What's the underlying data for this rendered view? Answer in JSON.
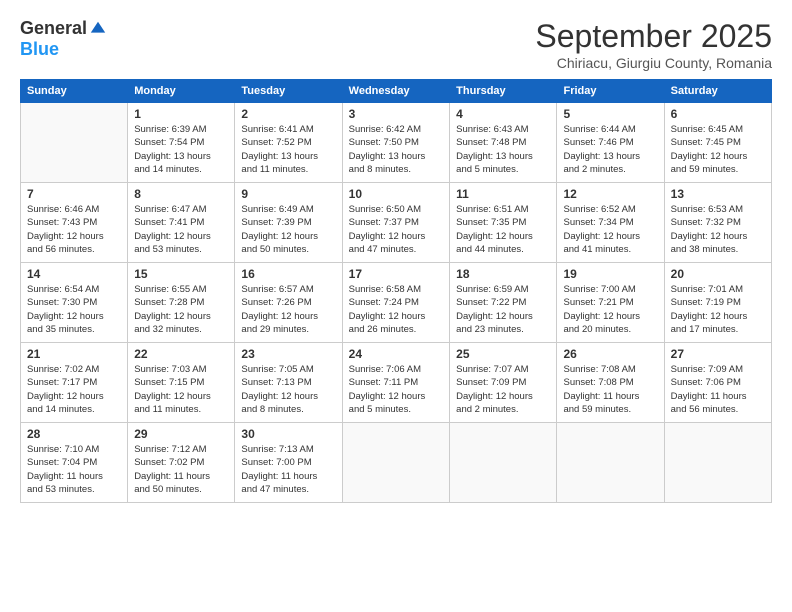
{
  "logo": {
    "general": "General",
    "blue": "Blue"
  },
  "title": "September 2025",
  "location": "Chiriacu, Giurgiu County, Romania",
  "weekdays": [
    "Sunday",
    "Monday",
    "Tuesday",
    "Wednesday",
    "Thursday",
    "Friday",
    "Saturday"
  ],
  "weeks": [
    [
      {
        "day": "",
        "info": ""
      },
      {
        "day": "1",
        "info": "Sunrise: 6:39 AM\nSunset: 7:54 PM\nDaylight: 13 hours\nand 14 minutes."
      },
      {
        "day": "2",
        "info": "Sunrise: 6:41 AM\nSunset: 7:52 PM\nDaylight: 13 hours\nand 11 minutes."
      },
      {
        "day": "3",
        "info": "Sunrise: 6:42 AM\nSunset: 7:50 PM\nDaylight: 13 hours\nand 8 minutes."
      },
      {
        "day": "4",
        "info": "Sunrise: 6:43 AM\nSunset: 7:48 PM\nDaylight: 13 hours\nand 5 minutes."
      },
      {
        "day": "5",
        "info": "Sunrise: 6:44 AM\nSunset: 7:46 PM\nDaylight: 13 hours\nand 2 minutes."
      },
      {
        "day": "6",
        "info": "Sunrise: 6:45 AM\nSunset: 7:45 PM\nDaylight: 12 hours\nand 59 minutes."
      }
    ],
    [
      {
        "day": "7",
        "info": "Sunrise: 6:46 AM\nSunset: 7:43 PM\nDaylight: 12 hours\nand 56 minutes."
      },
      {
        "day": "8",
        "info": "Sunrise: 6:47 AM\nSunset: 7:41 PM\nDaylight: 12 hours\nand 53 minutes."
      },
      {
        "day": "9",
        "info": "Sunrise: 6:49 AM\nSunset: 7:39 PM\nDaylight: 12 hours\nand 50 minutes."
      },
      {
        "day": "10",
        "info": "Sunrise: 6:50 AM\nSunset: 7:37 PM\nDaylight: 12 hours\nand 47 minutes."
      },
      {
        "day": "11",
        "info": "Sunrise: 6:51 AM\nSunset: 7:35 PM\nDaylight: 12 hours\nand 44 minutes."
      },
      {
        "day": "12",
        "info": "Sunrise: 6:52 AM\nSunset: 7:34 PM\nDaylight: 12 hours\nand 41 minutes."
      },
      {
        "day": "13",
        "info": "Sunrise: 6:53 AM\nSunset: 7:32 PM\nDaylight: 12 hours\nand 38 minutes."
      }
    ],
    [
      {
        "day": "14",
        "info": "Sunrise: 6:54 AM\nSunset: 7:30 PM\nDaylight: 12 hours\nand 35 minutes."
      },
      {
        "day": "15",
        "info": "Sunrise: 6:55 AM\nSunset: 7:28 PM\nDaylight: 12 hours\nand 32 minutes."
      },
      {
        "day": "16",
        "info": "Sunrise: 6:57 AM\nSunset: 7:26 PM\nDaylight: 12 hours\nand 29 minutes."
      },
      {
        "day": "17",
        "info": "Sunrise: 6:58 AM\nSunset: 7:24 PM\nDaylight: 12 hours\nand 26 minutes."
      },
      {
        "day": "18",
        "info": "Sunrise: 6:59 AM\nSunset: 7:22 PM\nDaylight: 12 hours\nand 23 minutes."
      },
      {
        "day": "19",
        "info": "Sunrise: 7:00 AM\nSunset: 7:21 PM\nDaylight: 12 hours\nand 20 minutes."
      },
      {
        "day": "20",
        "info": "Sunrise: 7:01 AM\nSunset: 7:19 PM\nDaylight: 12 hours\nand 17 minutes."
      }
    ],
    [
      {
        "day": "21",
        "info": "Sunrise: 7:02 AM\nSunset: 7:17 PM\nDaylight: 12 hours\nand 14 minutes."
      },
      {
        "day": "22",
        "info": "Sunrise: 7:03 AM\nSunset: 7:15 PM\nDaylight: 12 hours\nand 11 minutes."
      },
      {
        "day": "23",
        "info": "Sunrise: 7:05 AM\nSunset: 7:13 PM\nDaylight: 12 hours\nand 8 minutes."
      },
      {
        "day": "24",
        "info": "Sunrise: 7:06 AM\nSunset: 7:11 PM\nDaylight: 12 hours\nand 5 minutes."
      },
      {
        "day": "25",
        "info": "Sunrise: 7:07 AM\nSunset: 7:09 PM\nDaylight: 12 hours\nand 2 minutes."
      },
      {
        "day": "26",
        "info": "Sunrise: 7:08 AM\nSunset: 7:08 PM\nDaylight: 11 hours\nand 59 minutes."
      },
      {
        "day": "27",
        "info": "Sunrise: 7:09 AM\nSunset: 7:06 PM\nDaylight: 11 hours\nand 56 minutes."
      }
    ],
    [
      {
        "day": "28",
        "info": "Sunrise: 7:10 AM\nSunset: 7:04 PM\nDaylight: 11 hours\nand 53 minutes."
      },
      {
        "day": "29",
        "info": "Sunrise: 7:12 AM\nSunset: 7:02 PM\nDaylight: 11 hours\nand 50 minutes."
      },
      {
        "day": "30",
        "info": "Sunrise: 7:13 AM\nSunset: 7:00 PM\nDaylight: 11 hours\nand 47 minutes."
      },
      {
        "day": "",
        "info": ""
      },
      {
        "day": "",
        "info": ""
      },
      {
        "day": "",
        "info": ""
      },
      {
        "day": "",
        "info": ""
      }
    ]
  ]
}
